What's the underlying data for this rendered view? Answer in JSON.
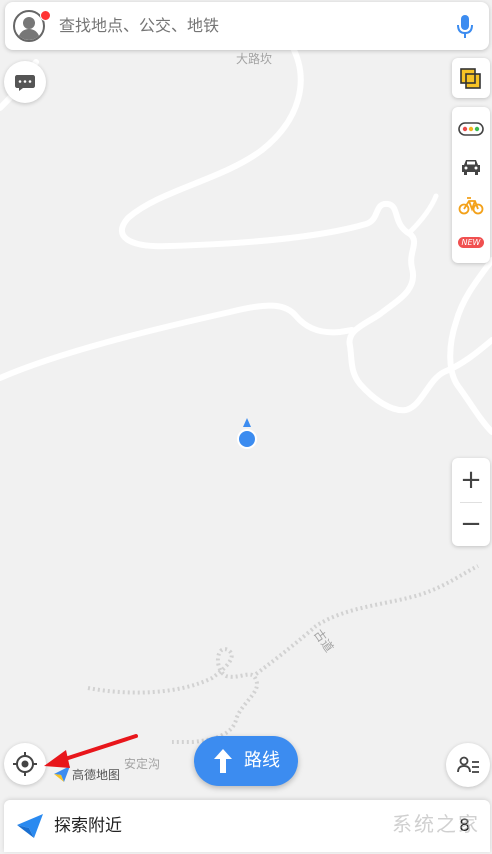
{
  "search": {
    "placeholder": "查找地点、公交、地铁"
  },
  "map": {
    "labels": {
      "top_place": "大路坎",
      "road_name": "古道",
      "bottom_place": "安定沟"
    },
    "colors": {
      "background": "#f1f1f1",
      "road": "#ffffff",
      "trail": "#d2d2d2",
      "location": "#3c8cf0"
    }
  },
  "tools": {
    "new_badge": "NEW"
  },
  "zoom": {
    "in": "+",
    "out": "−"
  },
  "logo": {
    "text": "高德地图"
  },
  "route": {
    "label": "路线"
  },
  "bottom": {
    "explore_label": "探索附近",
    "partial_text": "8"
  },
  "watermark": {
    "text": "系统之家"
  },
  "annotation": {
    "arrow_color": "#e8161b"
  }
}
